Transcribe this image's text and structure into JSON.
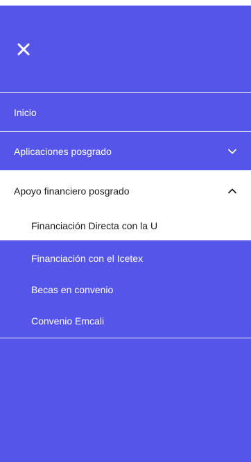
{
  "menu": {
    "close_icon": "close-icon",
    "items": [
      {
        "label": "Inicio"
      },
      {
        "label": "Aplicaciones posgrado",
        "icon": "chevron-down-icon"
      }
    ],
    "open_group": {
      "label": "Apoyo financiero posgrado",
      "icon": "chevron-up-icon",
      "children": [
        {
          "label": "Financiación Directa con la U"
        },
        {
          "label": "Financiación con el Icetex"
        },
        {
          "label": "Becas en convenio"
        },
        {
          "label": "Convenio Emcali"
        }
      ]
    }
  },
  "colors": {
    "panel_bg": "#5555ea",
    "active_bg": "#ffffff",
    "text_light": "#ffffff",
    "text_dark": "#1b1b1b"
  }
}
